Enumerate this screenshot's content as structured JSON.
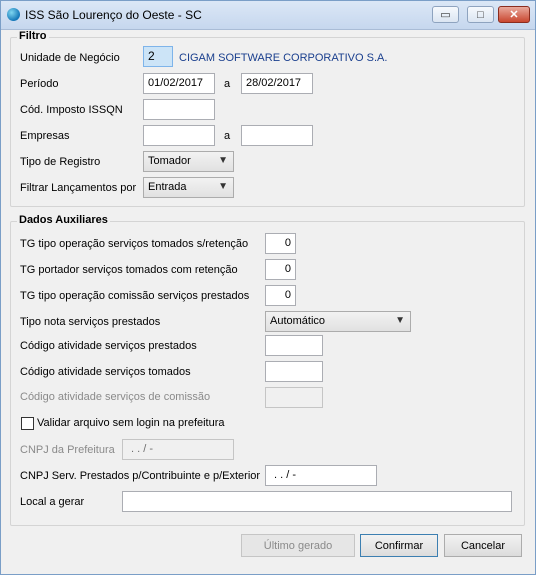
{
  "window": {
    "title": "ISS São Lourenço do Oeste - SC",
    "minimize": "▭",
    "maximize": "□",
    "close": "✕"
  },
  "filtro": {
    "title": "Filtro",
    "unidade_label": "Unidade de Negócio",
    "unidade_code": "2",
    "unidade_name": "CIGAM SOFTWARE CORPORATIVO S.A.",
    "periodo_label": "Período",
    "periodo_from": "01/02/2017",
    "periodo_sep": "a",
    "periodo_to": "28/02/2017",
    "cod_imposto_label": "Cód. Imposto ISSQN",
    "cod_imposto_value": "",
    "empresas_label": "Empresas",
    "empresas_from": "",
    "empresas_sep": "a",
    "empresas_to": "",
    "tipo_registro_label": "Tipo de Registro",
    "tipo_registro_value": "Tomador",
    "filtrar_label": "Filtrar Lançamentos por",
    "filtrar_value": "Entrada"
  },
  "dados": {
    "title": "Dados Auxiliares",
    "tg_tomados_label": "TG tipo operação serviços tomados s/retenção",
    "tg_tomados_value": "0",
    "tg_portador_label": "TG portador serviços tomados com retenção",
    "tg_portador_value": "0",
    "tg_comissao_label": "TG tipo operação comissão serviços prestados",
    "tg_comissao_value": "0",
    "tipo_nota_label": "Tipo nota serviços prestados",
    "tipo_nota_value": "Automático",
    "cod_prestados_label": "Código atividade serviços prestados",
    "cod_prestados_value": "",
    "cod_tomados_label": "Código atividade serviços tomados",
    "cod_tomados_value": "",
    "cod_comissao_label": "Código atividade serviços de comissão",
    "cod_comissao_value": "",
    "validar_label": "Validar arquivo sem login na prefeitura",
    "cnpj_prefeitura_label": "CNPJ da Prefeitura",
    "cnpj_prefeitura_value": ". . / -",
    "cnpj_serv_label": "CNPJ Serv. Prestados p/Contribuinte e p/Exterior",
    "cnpj_serv_value": ". . / -",
    "local_label": "Local a gerar",
    "local_value": ""
  },
  "buttons": {
    "ultimo": "Último gerado",
    "confirmar": "Confirmar",
    "cancelar": "Cancelar"
  },
  "icons": {
    "dropdown": "chevron-down-icon",
    "app": "app-icon"
  }
}
